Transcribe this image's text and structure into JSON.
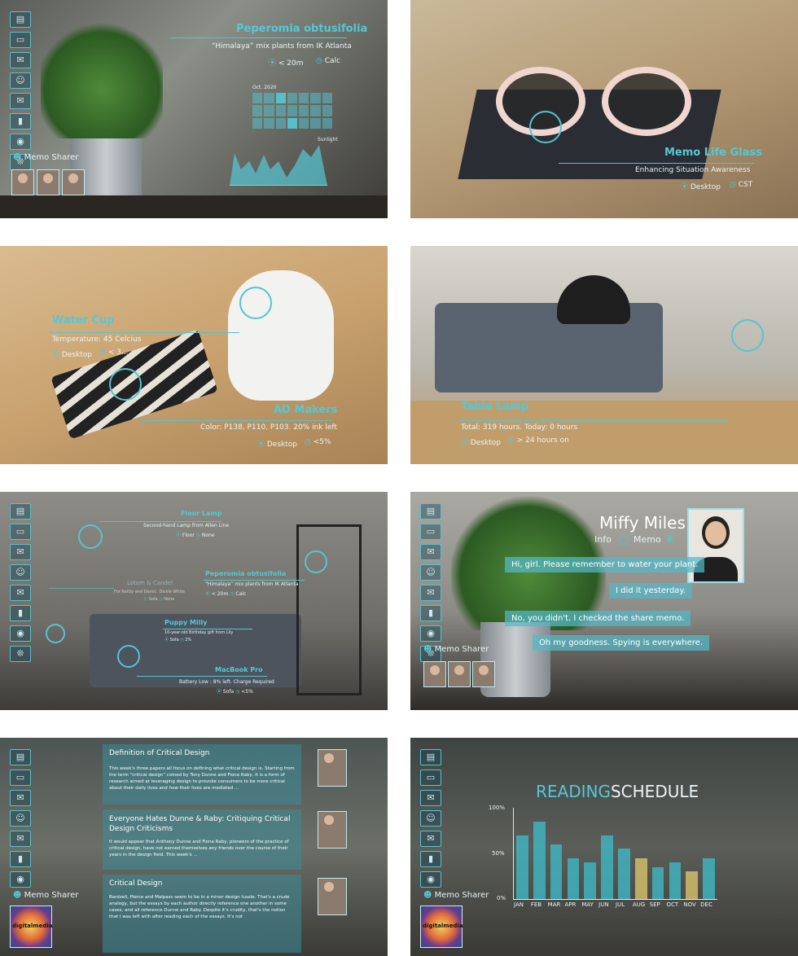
{
  "panels": {
    "plant": {
      "title": "Peperomia obtusifolia",
      "subtitle": "“Himalaya” mix plants from IK Atlanta",
      "meta_distance": "< 20m",
      "meta_action": "Calc",
      "calendar_label": "Oct. 2020",
      "chart_legend": "Sunlight",
      "sharer_label": "Memo Sharer"
    },
    "glass": {
      "title": "Memo Life Glass",
      "subtitle": "Enhancing Situation Awareness",
      "meta_location": "Desktop",
      "meta_time": "CST"
    },
    "cup": {
      "title1": "Water Cup",
      "line1": "Temperature: 45 Celcius",
      "meta1_location": "Desktop",
      "meta1_extra": "< 3...",
      "title2": "AD Makers",
      "line2": "Color: P138, P110, P103. 20% ink left",
      "meta2_location": "Desktop",
      "meta2_extra": "<5%"
    },
    "lamp": {
      "title": "Table Lamp",
      "line": "Total: 319 hours.  Today: 0 hours",
      "meta_location": "Desktop",
      "meta_extra": "> 24 hours on"
    },
    "room": {
      "floor_lamp": "Floor Lamp",
      "floor_lamp_sub": "Second-hand Lamp from Allen Line",
      "floor_lamp_meta1": "Floor",
      "floor_lamp_meta2": "None",
      "plant": "Peperomia obtusifolia",
      "plant_sub": "“Himalaya” mix plants from IK Atlanta",
      "plant_meta1": "< 20m",
      "plant_meta2": "Calc",
      "candle": "Lotom & Candel",
      "candle_sub": "For Rattly and Dionic. Dickle White",
      "candle_meta1": "Sofa",
      "candle_meta2": "None",
      "puppy": "Puppy Milly",
      "puppy_sub": "10-year-old Birthday gift from Lily",
      "puppy_meta1": "Sofa",
      "puppy_meta2": "2%",
      "macbook": "MacBook Pro",
      "macbook_sub": "Battery Low : 8% left. Charge Required",
      "macbook_meta1": "Sofa",
      "macbook_meta2": "<5%"
    },
    "chat": {
      "name": "Miffy Miles",
      "tab_info": "Info",
      "tab_memo": "Memo",
      "messages": [
        "Hi, girl. Please remember to water your plant.",
        "I did it yesterday.",
        "No, you didn't. I checked the share memo.",
        "Oh my goodness. Spying is everywhere."
      ],
      "sharer_label": "Memo Sharer"
    },
    "docs": {
      "card1_title": "Definition of Critical Design",
      "card1_body": "This week's three papers all focus on defining what critical design is. Starting from the term \"critical design\" coined by Tony Dunne and Fiona Raby, it is a form of research aimed at leveraging design to provoke consumers to be more critical about their daily lives and how their lives are mediated ...",
      "card2_title": "Everyone Hates Dunne & Raby: Critiquing Critical Design Criticisms",
      "card2_body": "It would appear that Anthony Dunne and Fiona Raby, pioneers of the practice of critical design, have not earned themselves any friends over the course of their years in the design field. This week's ...",
      "card3_title": "Critical Design",
      "card3_body": "Bardzell, Pierce and Malpass seem to be in a minor design tussle. That's a crude analogy, but the essays by each author directly reference one another in some cases, and all reference Dunne and Raby. Despite it's crudity, that's the notion that I was left with after reading each of the essays. It's not",
      "sharer_label": "Memo Sharer",
      "logo_text": "digitalmedia"
    },
    "reading": {
      "title_a": "READING",
      "title_b": "SCHEDULE",
      "sharer_label": "Memo Sharer",
      "logo_text": "digitalmedia"
    }
  },
  "chart_data": {
    "type": "bar",
    "title": "READINGSCHEDULE",
    "categories": [
      "JAN",
      "FEB",
      "MAR",
      "APR",
      "MAY",
      "JUN",
      "JUL",
      "AUG",
      "SEP",
      "OCT",
      "NOV",
      "DEC"
    ],
    "y_ticks": [
      "100%",
      "50%",
      "0%"
    ],
    "ylim": [
      0,
      100
    ],
    "series": [
      {
        "values": [
          70,
          85,
          60,
          45,
          40,
          70,
          55,
          45,
          35,
          40,
          30,
          45
        ]
      }
    ],
    "colors": {
      "cyan": "#3fb8c6",
      "yellow": "#d9c36a"
    }
  }
}
